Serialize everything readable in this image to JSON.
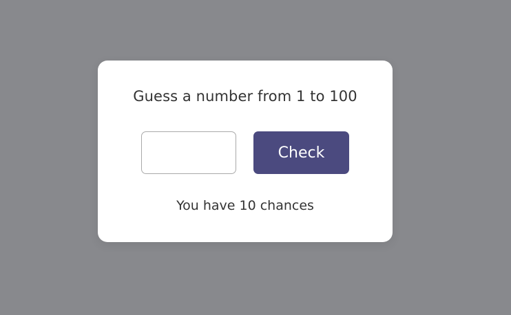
{
  "colors": {
    "background": "#88898d",
    "card": "#ffffff",
    "accent": "#4b4a7f",
    "text": "#333333"
  },
  "game": {
    "prompt": "Guess a number from 1 to 100",
    "input": {
      "value": "",
      "placeholder": ""
    },
    "check_label": "Check",
    "chances_text": "You have 10 chances"
  }
}
